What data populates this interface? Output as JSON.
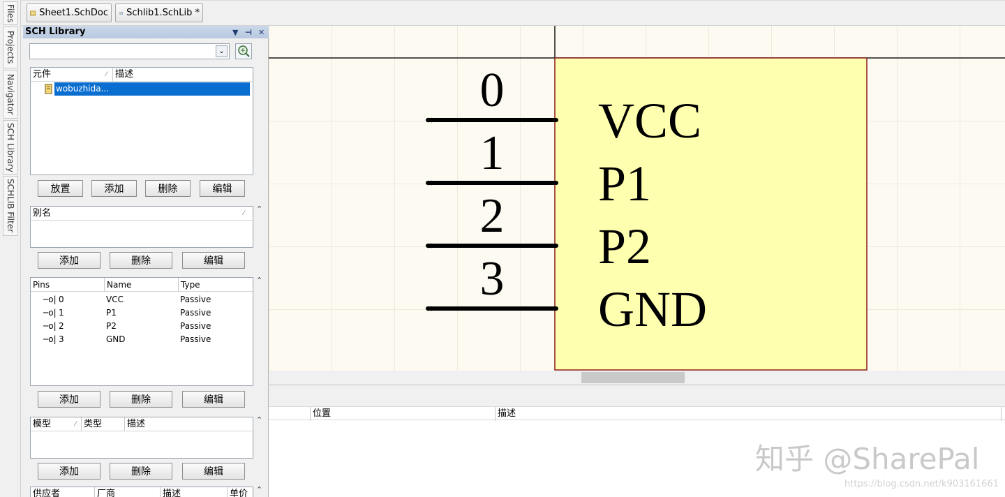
{
  "side_tabs": [
    "Files",
    "Projects",
    "Navigator",
    "SCH Library",
    "SCHLIB Filter"
  ],
  "doc_tabs": [
    "Sheet1.SchDoc",
    "Schlib1.SchLib *"
  ],
  "panel": {
    "title": "SCH Library",
    "search_value": "",
    "components": {
      "headers": [
        "元件",
        "描述"
      ],
      "items": [
        "wobuzhida..."
      ]
    },
    "component_buttons": [
      "放置",
      "添加",
      "删除",
      "编辑"
    ],
    "aliases": {
      "header": "别名"
    },
    "alias_buttons": [
      "添加",
      "删除",
      "编辑"
    ],
    "pins": {
      "headers": [
        "Pins",
        "Name",
        "Type"
      ],
      "rows": [
        {
          "pin": "0",
          "name": "VCC",
          "type": "Passive"
        },
        {
          "pin": "1",
          "name": "P1",
          "type": "Passive"
        },
        {
          "pin": "2",
          "name": "P2",
          "type": "Passive"
        },
        {
          "pin": "3",
          "name": "GND",
          "type": "Passive"
        }
      ]
    },
    "pin_buttons": [
      "添加",
      "删除",
      "编辑"
    ],
    "models": {
      "headers": [
        "模型",
        "类型",
        "描述"
      ]
    },
    "model_buttons": [
      "添加",
      "删除",
      "编辑"
    ],
    "suppliers": {
      "headers": [
        "供应者",
        "厂商",
        "描述",
        "单价"
      ]
    }
  },
  "schematic": {
    "pin_numbers": [
      "0",
      "1",
      "2",
      "3"
    ],
    "pin_names": [
      "VCC",
      "P1",
      "P2",
      "GND"
    ],
    "body_color": "#ffffb0",
    "body_border": "#8b1a1a"
  },
  "bottom_headers": [
    "位置",
    "描述"
  ],
  "watermark": "知乎 @SharePal",
  "watermark_url": "https://blog.csdn.net/k903161661"
}
